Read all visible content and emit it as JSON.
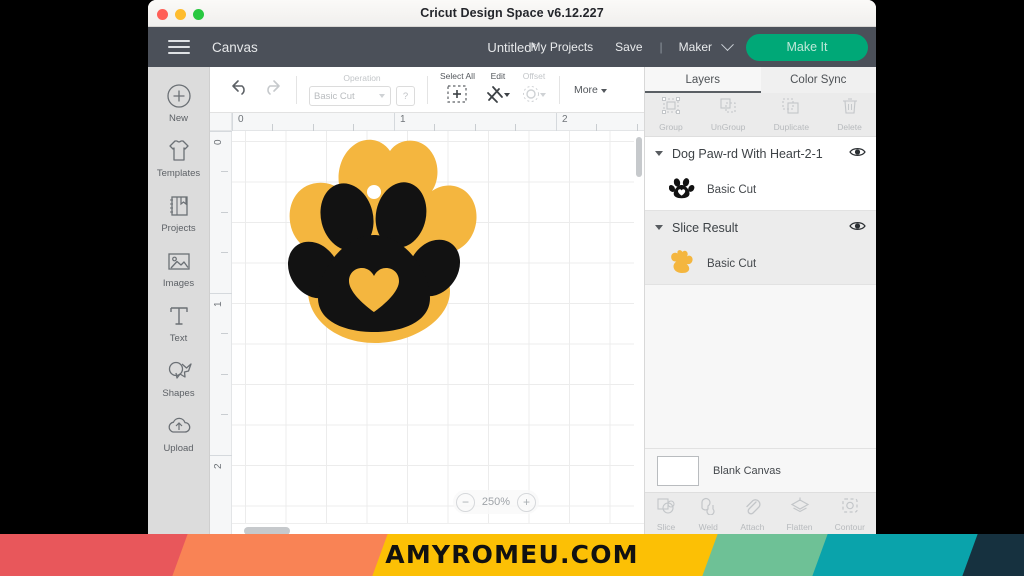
{
  "window": {
    "title": "Cricut Design Space  v6.12.227",
    "traffic_lights": [
      "close",
      "minimize",
      "maximize"
    ]
  },
  "navbar": {
    "menu_icon": "hamburger-icon",
    "canvas_label": "Canvas",
    "document_title": "Untitled*",
    "my_projects": "My Projects",
    "save": "Save",
    "separator": "|",
    "machine": "Maker",
    "make_it": "Make It",
    "make_it_color": "#00a877"
  },
  "sidebar": {
    "items": [
      {
        "label": "New",
        "icon": "plus-circle-icon"
      },
      {
        "label": "Templates",
        "icon": "tshirt-icon"
      },
      {
        "label": "Projects",
        "icon": "book-icon"
      },
      {
        "label": "Images",
        "icon": "image-icon"
      },
      {
        "label": "Text",
        "icon": "text-icon"
      },
      {
        "label": "Shapes",
        "icon": "shapes-icon"
      },
      {
        "label": "Upload",
        "icon": "upload-cloud-icon"
      }
    ]
  },
  "toolbar": {
    "undo": "undo-icon",
    "redo": "redo-icon",
    "operation_label": "Operation",
    "operation_value": "Basic Cut",
    "help_button": "?",
    "select_all_label": "Select All",
    "edit_label": "Edit",
    "offset_label": "Offset",
    "more_label": "More"
  },
  "canvas": {
    "ruler_h_labels": [
      "0",
      "1",
      "2"
    ],
    "ruler_v_labels": [
      "0",
      "1",
      "2"
    ],
    "zoom_level": "250%",
    "zoom_out": "−",
    "zoom_in": "+",
    "artwork": {
      "name": "dog-paw-with-heart",
      "backing_color": "#f4b63f",
      "paw_color": "#121212",
      "heart_color": "#f4b63f",
      "hole_color": "#ffffff"
    }
  },
  "panel": {
    "tabs": [
      {
        "label": "Layers",
        "active": true
      },
      {
        "label": "Color Sync",
        "active": false
      }
    ],
    "actions": [
      {
        "label": "Group",
        "icon": "group-icon"
      },
      {
        "label": "UnGroup",
        "icon": "ungroup-icon"
      },
      {
        "label": "Duplicate",
        "icon": "duplicate-icon"
      },
      {
        "label": "Delete",
        "icon": "trash-icon"
      }
    ],
    "layers": [
      {
        "title": "Dog Paw-rd With Heart-2-1",
        "visibility_icon": "eye-icon",
        "child_label": "Basic Cut",
        "child_swatch": "#121212",
        "selected": false
      },
      {
        "title": "Slice Result",
        "visibility_icon": "eye-icon",
        "child_label": "Basic Cut",
        "child_swatch": "#f4b63f",
        "selected": true
      }
    ],
    "blank_canvas_label": "Blank Canvas",
    "bottom_tools": [
      {
        "label": "Slice",
        "icon": "slice-icon"
      },
      {
        "label": "Weld",
        "icon": "weld-icon"
      },
      {
        "label": "Attach",
        "icon": "paperclip-icon"
      },
      {
        "label": "Flatten",
        "icon": "flatten-icon"
      },
      {
        "label": "Contour",
        "icon": "contour-icon"
      }
    ]
  },
  "footer": {
    "text": "AMYROMEU.COM",
    "stripe_colors": [
      "#e8575b",
      "#f98355",
      "#fcc005",
      "#6ec196",
      "#0aa3ab",
      "#16313f"
    ]
  }
}
